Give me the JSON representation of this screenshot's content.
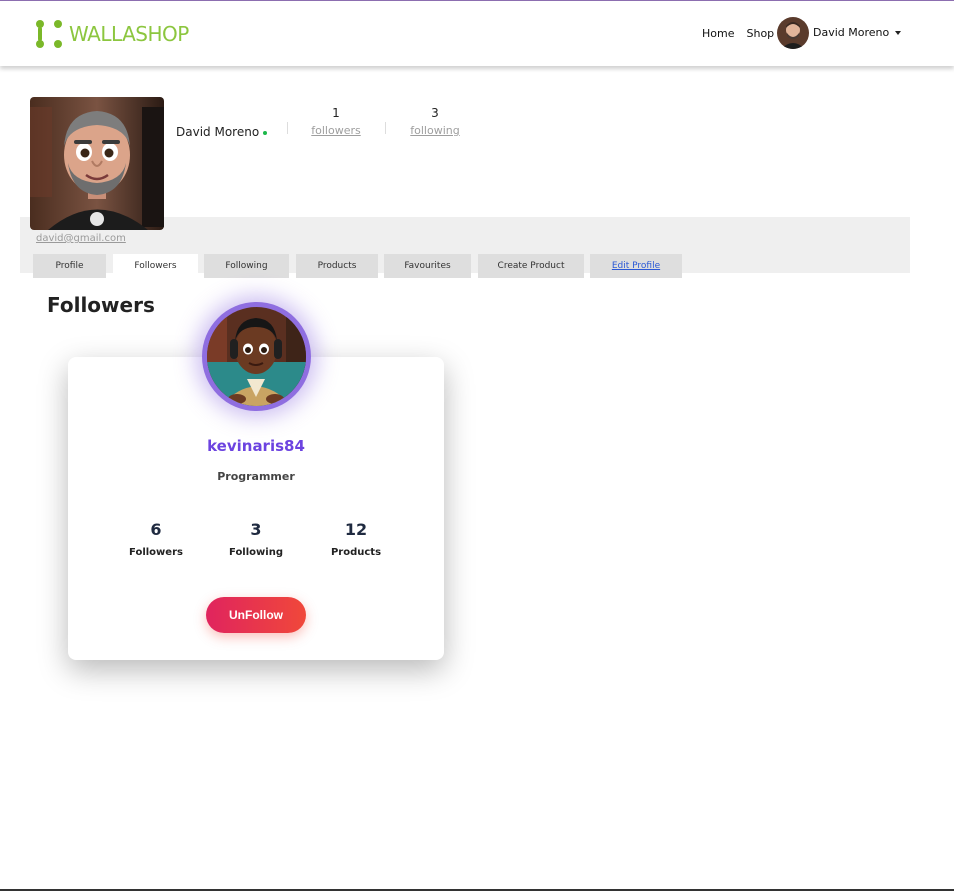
{
  "navbar": {
    "brand": "WALLASHOP",
    "links": {
      "home": "Home",
      "shop": "Shop"
    },
    "user_name": "David Moreno"
  },
  "profile": {
    "name": "David Moreno",
    "followers_count": "1",
    "followers_label": "followers",
    "following_count": "3",
    "following_label": "following",
    "email": "david@gmail.com"
  },
  "tabs": [
    {
      "label": "Profile"
    },
    {
      "label": "Followers"
    },
    {
      "label": "Following"
    },
    {
      "label": "Products"
    },
    {
      "label": "Favourites"
    },
    {
      "label": "Create Product"
    },
    {
      "label": "Edit Profile"
    }
  ],
  "section_title": "Followers",
  "follower_card": {
    "username": "kevinaris84",
    "role": "Programmer",
    "stats": [
      {
        "value": "6",
        "label": "Followers"
      },
      {
        "value": "3",
        "label": "Following"
      },
      {
        "value": "12",
        "label": "Products"
      }
    ],
    "action_label": "UnFollow"
  },
  "colors": {
    "brand_green": "#8cc63f",
    "accent_purple": "#6c43e0",
    "unfollow_gradient_start": "#e0245e",
    "unfollow_gradient_end": "#f0483a",
    "online": "#1cb84a"
  }
}
